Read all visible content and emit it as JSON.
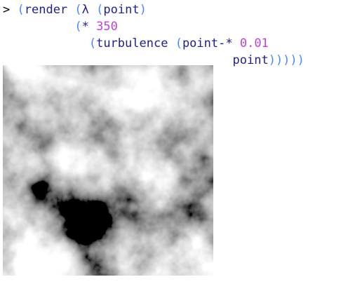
{
  "repl": {
    "prompt": ">",
    "lines": [
      {
        "indent": 0,
        "parts": [
          "(render (λ (point)"
        ]
      },
      {
        "indent": 0,
        "parts": [
          "(* 350"
        ]
      },
      {
        "indent": 0,
        "parts": [
          "(turbulence (point-* 0.01"
        ]
      },
      {
        "indent": 0,
        "parts": [
          "point)))))"
        ]
      }
    ],
    "tokens": {
      "l1_open": "(",
      "l1_render": "render",
      "l1_lambda": "λ",
      "l1_open2": "(",
      "l1_point": "point",
      "l1_close": ")",
      "l2_open": "(",
      "l2_star": "*",
      "l2_num": "350",
      "l3_open": "(",
      "l3_turb": "turbulence",
      "l3_open2": "(",
      "l3_pointstar": "point-*",
      "l3_num": "0.01",
      "l4_point": "point",
      "l4_close": ")))))"
    }
  },
  "output_image": {
    "description_icon": "turbulence-noise-image",
    "colors": {
      "background": "#000000",
      "foreground": "#ffffff"
    }
  }
}
